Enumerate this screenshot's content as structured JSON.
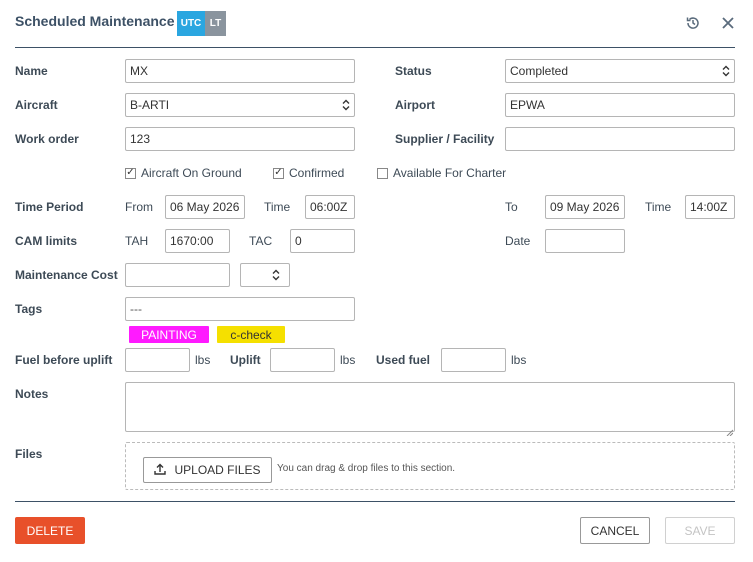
{
  "header": {
    "title": "Scheduled Maintenance",
    "tz_utc": "UTC",
    "tz_lt": "LT",
    "history_icon": "history-icon",
    "close_icon": "close-icon"
  },
  "form": {
    "name": {
      "label": "Name",
      "value": "MX"
    },
    "status": {
      "label": "Status",
      "value": "Completed"
    },
    "aircraft": {
      "label": "Aircraft",
      "value": "B-ARTI"
    },
    "airport": {
      "label": "Airport",
      "value": "EPWA"
    },
    "work_order": {
      "label": "Work order",
      "value": "123"
    },
    "supplier": {
      "label": "Supplier / Facility",
      "value": ""
    },
    "checks": [
      {
        "label": "Aircraft On Ground",
        "checked": true
      },
      {
        "label": "Confirmed",
        "checked": true
      },
      {
        "label": "Available For Charter",
        "checked": false
      }
    ],
    "time_period": {
      "label": "Time Period",
      "from_label": "From",
      "from_date": "06 May 2026",
      "time_label": "Time",
      "from_time": "06:00Z",
      "to_label": "To",
      "to_date": "09 May 2026",
      "to_time_label": "Time",
      "to_time": "14:00Z"
    },
    "cam_limits": {
      "label": "CAM limits",
      "tah_label": "TAH",
      "tah_value": "1670:00",
      "tac_label": "TAC",
      "tac_value": "0",
      "date_label": "Date",
      "date_value": ""
    },
    "maintenance_cost": {
      "label": "Maintenance Cost",
      "value": "",
      "currency": ""
    },
    "tags": {
      "label": "Tags",
      "placeholder": "---",
      "items": [
        {
          "label": "PAINTING",
          "color": "#ff1aff",
          "text_color": "#ffffff"
        },
        {
          "label": "c-check",
          "color": "#f5e000",
          "text_color": "#333333"
        }
      ]
    },
    "fuel": {
      "label": "Fuel before uplift",
      "before_value": "",
      "unit": "lbs",
      "uplift_label": "Uplift",
      "uplift_value": "",
      "used_label": "Used fuel",
      "used_value": ""
    },
    "notes": {
      "label": "Notes",
      "value": ""
    },
    "files": {
      "label": "Files",
      "upload_label": "UPLOAD FILES",
      "hint": "You can drag & drop files to this section.",
      "upload_icon": "upload-icon"
    }
  },
  "footer": {
    "delete_label": "DELETE",
    "cancel_label": "CANCEL",
    "save_label": "SAVE",
    "delete_color": "#e8502a"
  }
}
